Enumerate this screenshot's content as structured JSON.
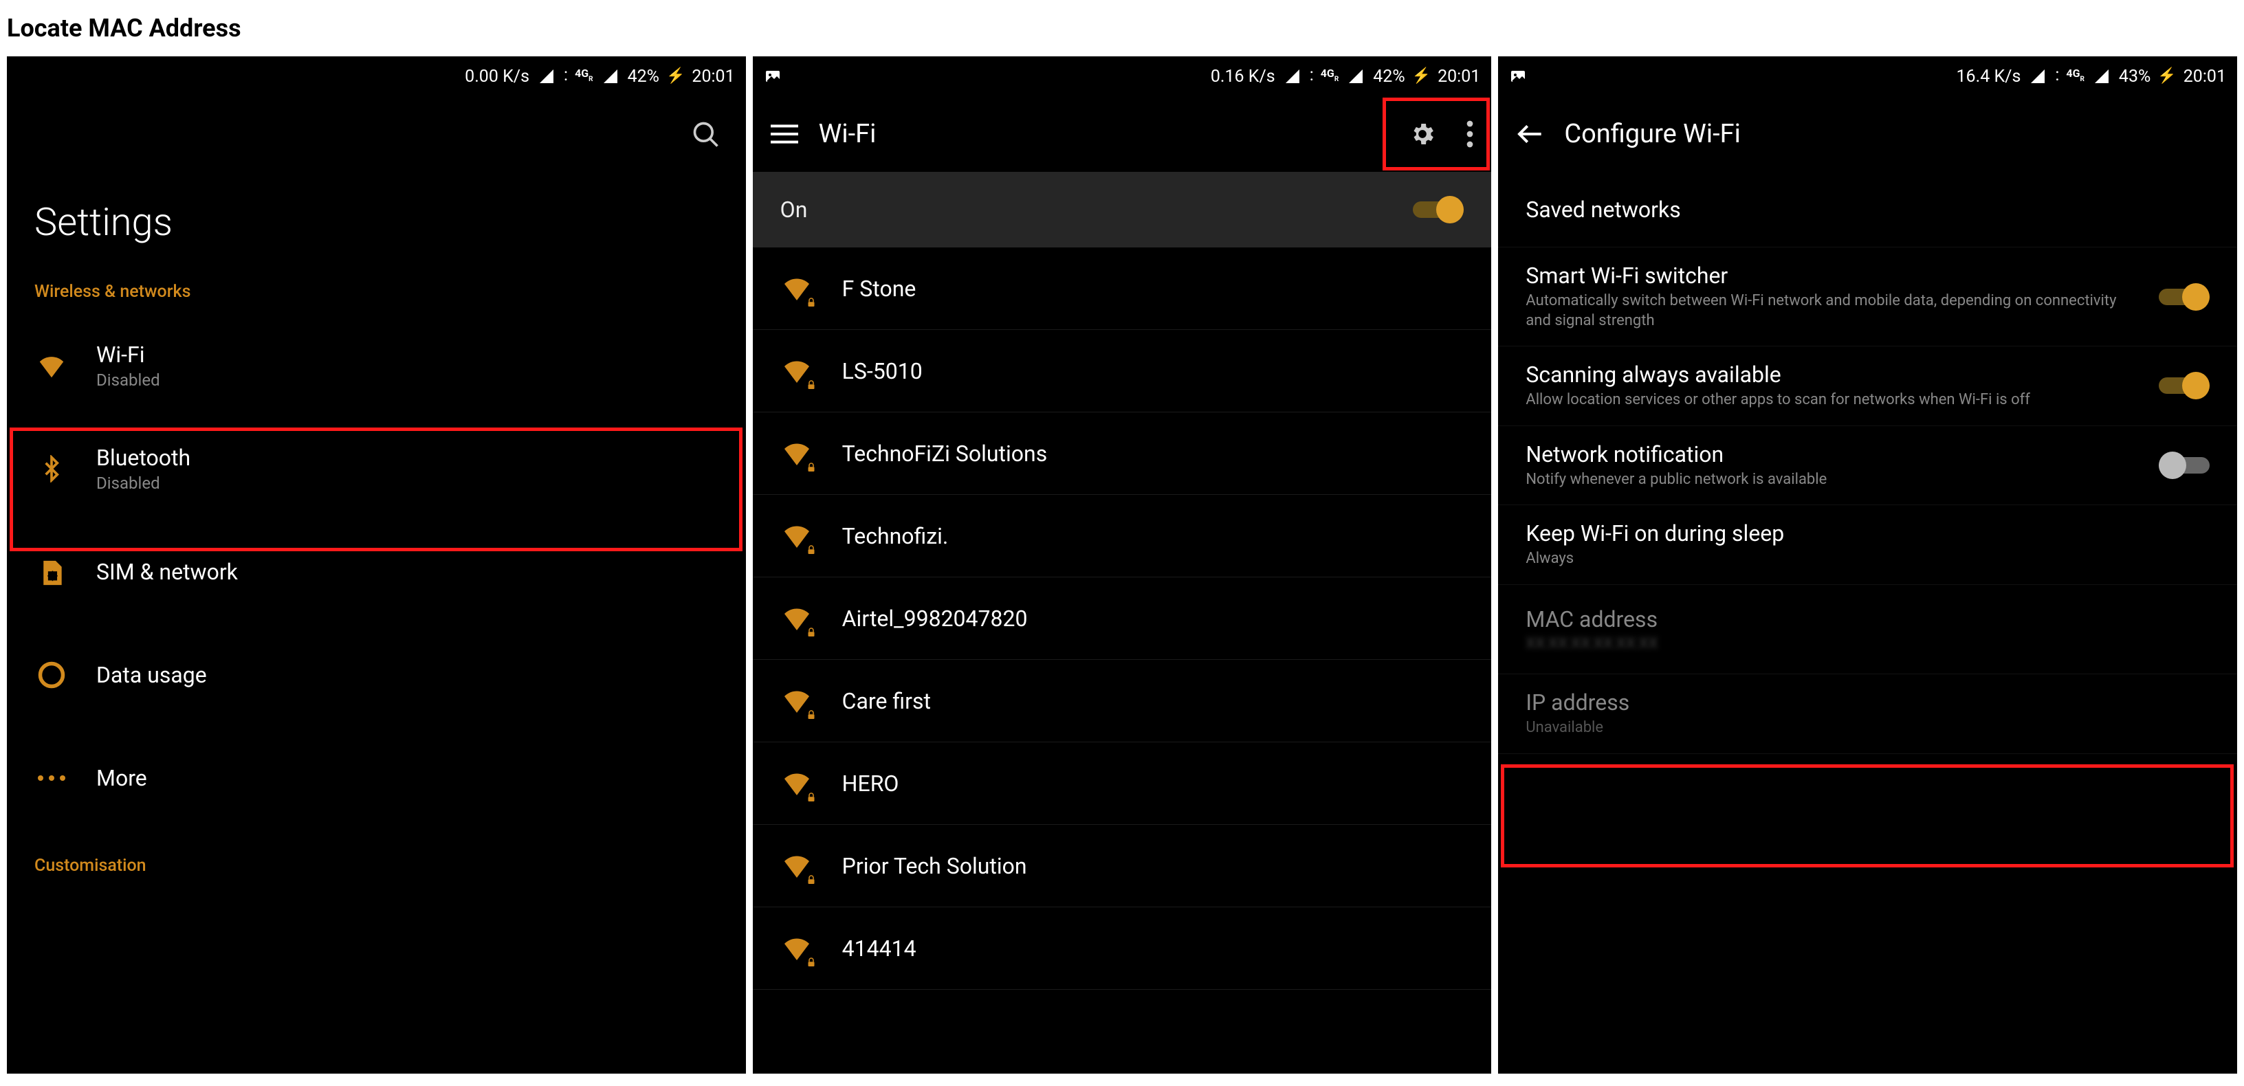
{
  "page_heading": "Locate MAC Address",
  "accent_color": "#e0a029",
  "phone1": {
    "statusbar": {
      "speed": "0.00 K/s",
      "net": "4G",
      "battery": "42%",
      "time": "20:01"
    },
    "title": "Settings",
    "section1": "Wireless & networks",
    "rows": [
      {
        "icon": "wifi",
        "primary": "Wi-Fi",
        "secondary": "Disabled"
      },
      {
        "icon": "bluetooth",
        "primary": "Bluetooth",
        "secondary": "Disabled"
      },
      {
        "icon": "sim",
        "primary": "SIM & network",
        "secondary": ""
      },
      {
        "icon": "data",
        "primary": "Data usage",
        "secondary": ""
      },
      {
        "icon": "more",
        "primary": "More",
        "secondary": ""
      }
    ],
    "section2": "Customisation"
  },
  "phone2": {
    "statusbar": {
      "speed": "0.16 K/s",
      "net": "4G",
      "battery": "42%",
      "time": "20:01"
    },
    "title": "Wi-Fi",
    "toggle_label": "On",
    "networks": [
      "F Stone",
      "LS-5010",
      "TechnoFiZi Solutions",
      "Technofizi.",
      "Airtel_9982047820",
      "Care first",
      "HERO",
      "Prior Tech Solution",
      "414414"
    ]
  },
  "phone3": {
    "statusbar": {
      "speed": "16.4 K/s",
      "net": "4G",
      "battery": "43%",
      "time": "20:01"
    },
    "title": "Configure Wi-Fi",
    "saved": "Saved networks",
    "items": {
      "smart": {
        "t1": "Smart Wi-Fi switcher",
        "t2": "Automatically switch between Wi-Fi network and mobile data, depending on connectivity and signal strength"
      },
      "scan": {
        "t1": "Scanning always available",
        "t2": "Allow location services or other apps to scan for networks when Wi-Fi is off"
      },
      "notif": {
        "t1": "Network notification",
        "t2": "Notify whenever a public network is available"
      },
      "keep": {
        "t1": "Keep Wi-Fi on during sleep",
        "t2": "Always"
      },
      "mac": {
        "t1": "MAC address",
        "t2": "XX:XX:XX:XX:XX:XX"
      },
      "ip": {
        "t1": "IP address",
        "t2": "Unavailable"
      }
    }
  }
}
